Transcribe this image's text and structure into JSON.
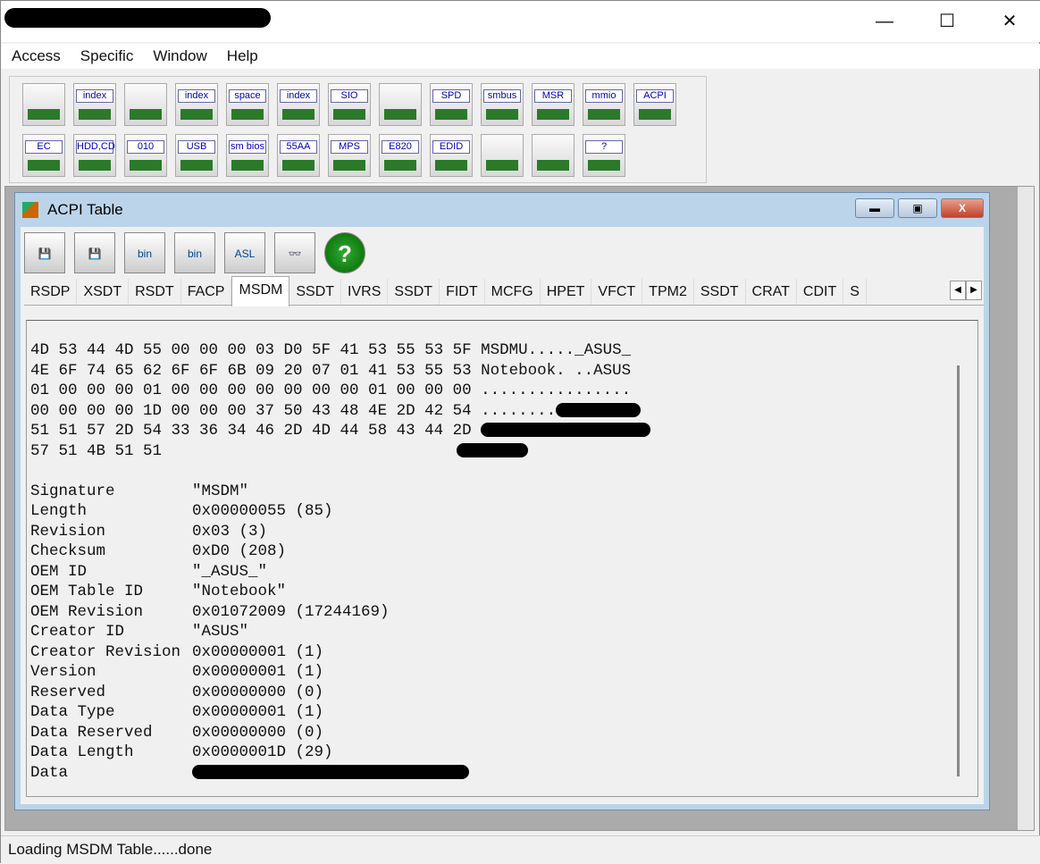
{
  "window": {
    "minimize": "—",
    "maximize": "☐",
    "close": "✕"
  },
  "menu": [
    "Access",
    "Specific",
    "Window",
    "Help"
  ],
  "toolbar": {
    "row1": [
      "",
      "index",
      "",
      "index",
      "space",
      "index",
      "SIO",
      "",
      "SPD",
      "smbus",
      "MSR",
      "mmio",
      "ACPI"
    ],
    "row2": [
      "EC",
      "HDD,CD",
      "010",
      "USB",
      "sm bios",
      "55AA",
      "MPS",
      "E820",
      "EDID",
      "",
      "",
      "?"
    ]
  },
  "child": {
    "title": "ACPI Table",
    "tools": [
      "",
      "",
      "bin",
      "bin",
      "ASL",
      "👓",
      "?"
    ]
  },
  "tabs": [
    "RSDP",
    "XSDT",
    "RSDT",
    "FACP",
    "MSDM",
    "SSDT",
    "IVRS",
    "SSDT",
    "FIDT",
    "MCFG",
    "HPET",
    "VFCT",
    "TPM2",
    "SSDT",
    "CRAT",
    "CDIT",
    "S"
  ],
  "active_tab": "MSDM",
  "hex": [
    "4D 53 44 4D 55 00 00 00 03 D0 5F 41 53 55 53 5F MSDMU....._ASUS_",
    "4E 6F 74 65 62 6F 6F 6B 09 20 07 01 41 53 55 53 Notebook. ..ASUS",
    "01 00 00 00 01 00 00 00 00 00 00 00 01 00 00 00 ................",
    "00 00 00 00 1D 00 00 00 37 50 43 48 4E 2D 42 54 ........",
    "51 51 57 2D 54 33 36 34 46 2D 4D 44 58 43 44 2D ",
    "57 51 4B 51 51"
  ],
  "fields": [
    [
      "Signature",
      "\"MSDM\""
    ],
    [
      "Length",
      "0x00000055 (85)"
    ],
    [
      "Revision",
      "0x03 (3)"
    ],
    [
      "Checksum",
      "0xD0 (208)"
    ],
    [
      "OEM ID",
      "\"_ASUS_\""
    ],
    [
      "OEM Table ID",
      "\"Notebook\""
    ],
    [
      "OEM Revision",
      "0x01072009 (17244169)"
    ],
    [
      "Creator ID",
      "\"ASUS\""
    ],
    [
      "Creator Revision",
      "0x00000001 (1)"
    ],
    [
      "Version",
      "0x00000001 (1)"
    ],
    [
      "Reserved",
      "0x00000000 (0)"
    ],
    [
      "Data Type",
      "0x00000001 (1)"
    ],
    [
      "Data Reserved",
      "0x00000000 (0)"
    ],
    [
      "Data Length",
      "0x0000001D (29)"
    ],
    [
      "Data",
      ""
    ]
  ],
  "status": "Loading MSDM Table......done"
}
